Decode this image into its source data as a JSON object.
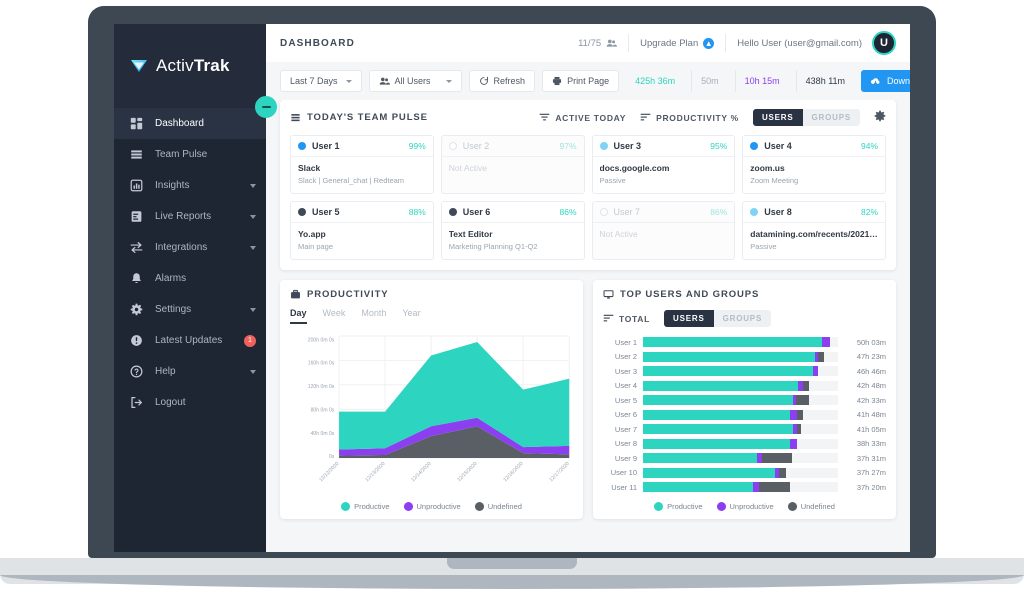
{
  "brand": {
    "name_light": "Activ",
    "name_bold": "Trak"
  },
  "sidebar": {
    "items": [
      {
        "label": "Dashboard",
        "icon": "grid-icon",
        "active": true,
        "chevron": false,
        "badge": null
      },
      {
        "label": "Team Pulse",
        "icon": "layers-icon",
        "active": false,
        "chevron": false,
        "badge": null
      },
      {
        "label": "Insights",
        "icon": "bar-chart-icon",
        "active": false,
        "chevron": true,
        "badge": null
      },
      {
        "label": "Live Reports",
        "icon": "report-icon",
        "active": false,
        "chevron": true,
        "badge": null
      },
      {
        "label": "Integrations",
        "icon": "arrows-icon",
        "active": false,
        "chevron": true,
        "badge": null
      },
      {
        "label": "Alarms",
        "icon": "bell-icon",
        "active": false,
        "chevron": false,
        "badge": null
      },
      {
        "label": "Settings",
        "icon": "gear-icon",
        "active": false,
        "chevron": true,
        "badge": null
      },
      {
        "label": "Latest Updates",
        "icon": "alert-icon",
        "active": false,
        "chevron": false,
        "badge": "1"
      },
      {
        "label": "Help",
        "icon": "question-icon",
        "active": false,
        "chevron": true,
        "badge": null
      },
      {
        "label": "Logout",
        "icon": "logout-icon",
        "active": false,
        "chevron": false,
        "badge": null
      }
    ],
    "collapse_icon": "minus-icon"
  },
  "header": {
    "title": "DASHBOARD",
    "seats": "11/75",
    "seats_icon": "users-icon",
    "upgrade_label": "Upgrade Plan",
    "upgrade_icon": "upgrade-icon",
    "greeting": "Hello User",
    "email": "(user@gmail.com)",
    "avatar_initial": "U"
  },
  "toolbar": {
    "date_range": "Last 7 Days",
    "user_filter": "All Users",
    "user_filter_icon": "people-icon",
    "refresh": "Refresh",
    "refresh_icon": "refresh-icon",
    "print": "Print Page",
    "print_icon": "printer-icon",
    "stat_productive": "425h 36m",
    "stat_unproductive": "50m",
    "stat_undefined": "10h 15m",
    "stat_total": "438h 11m",
    "download": "Download Agent",
    "download_icon": "cloud-download-icon",
    "colors": {
      "productive": "#2dd4bf",
      "unproductive": "#9b9ba4",
      "undefined": "#8b3ff0",
      "total": "#2f3945",
      "accent_blue": "#2196f3"
    }
  },
  "team_pulse": {
    "title": "TODAY'S TEAM PULSE",
    "title_icon": "pulse-icon",
    "sort_active": "ACTIVE TODAY",
    "sort_active_icon": "filter-icon",
    "sort_productivity": "PRODUCTIVITY %",
    "sort_productivity_icon": "sort-icon",
    "seg_users": "USERS",
    "seg_groups": "GROUPS",
    "settings_icon": "gear-icon",
    "cards": [
      {
        "name": "User 1",
        "pct": "99%",
        "app": "Slack",
        "sub": "Slack | General_chat | Redteam",
        "dot": "#2196f3",
        "active": true
      },
      {
        "name": "User 2",
        "pct": "97%",
        "app": "Not Active",
        "sub": "",
        "dot": "#ffffff",
        "active": false
      },
      {
        "name": "User 3",
        "pct": "95%",
        "app": "docs.google.com",
        "sub": "Passive",
        "dot": "#7fd4f5",
        "active": true
      },
      {
        "name": "User 4",
        "pct": "94%",
        "app": "zoom.us",
        "sub": "Zoom Meeting",
        "dot": "#2196f3",
        "active": true
      },
      {
        "name": "User 5",
        "pct": "88%",
        "app": "Yo.app",
        "sub": "Main page",
        "dot": "#3f4a58",
        "active": true
      },
      {
        "name": "User 6",
        "pct": "86%",
        "app": "Text Editor",
        "sub": "Marketing Planning Q1-Q2",
        "dot": "#3f4a58",
        "active": true
      },
      {
        "name": "User 7",
        "pct": "86%",
        "app": "Not Active",
        "sub": "",
        "dot": "#ffffff",
        "active": false
      },
      {
        "name": "User 8",
        "pct": "82%",
        "app": "datamining.com/recents/2021-r...",
        "sub": "Passive",
        "dot": "#7fd4f5",
        "active": true
      }
    ]
  },
  "productivity_panel": {
    "title": "PRODUCTIVITY",
    "title_icon": "briefcase-icon",
    "tabs": [
      {
        "label": "Day",
        "active": true
      },
      {
        "label": "Week",
        "active": false
      },
      {
        "label": "Month",
        "active": false
      },
      {
        "label": "Year",
        "active": false
      }
    ],
    "legend": [
      {
        "label": "Productive",
        "color": "#2dd4bf",
        "icon": "check-circle-icon"
      },
      {
        "label": "Unproductive",
        "color": "#8b3ff0",
        "icon": "minus-circle-icon"
      },
      {
        "label": "Undefined",
        "color": "#5a5f66",
        "icon": "question-circle-icon"
      }
    ]
  },
  "top_users_panel": {
    "title": "TOP USERS AND GROUPS",
    "title_icon": "monitor-icon",
    "total_label": "TOTAL",
    "total_icon": "sort-icon",
    "seg_users": "USERS",
    "seg_groups": "GROUPS",
    "legend": [
      {
        "label": "Productive",
        "color": "#2dd4bf",
        "icon": "check-circle-icon"
      },
      {
        "label": "Unproductive",
        "color": "#8b3ff0",
        "icon": "minus-circle-icon"
      },
      {
        "label": "Undefined",
        "color": "#5a5f66",
        "icon": "question-circle-icon"
      }
    ]
  },
  "chart_data": [
    {
      "type": "area",
      "stacked": true,
      "title": "PRODUCTIVITY",
      "xlabel": "",
      "ylabel": "",
      "grid": true,
      "legend_position": "bottom",
      "x": [
        "12/12/2020",
        "12/13/2020",
        "12/14/2020",
        "12/15/2020",
        "12/16/2020",
        "12/17/2020"
      ],
      "ytick_labels": [
        "200h 0m 0s",
        "160h 0m 0s",
        "120h 0m 0s",
        "80h 0m 0s",
        "40h 0m 0s",
        "0s"
      ],
      "ytick_values": [
        200,
        160,
        120,
        80,
        40,
        0
      ],
      "ylim": [
        0,
        200
      ],
      "series": [
        {
          "name": "Undefined",
          "color": "#5a5f66",
          "values": [
            4,
            5,
            36,
            52,
            8,
            6
          ]
        },
        {
          "name": "Unproductive",
          "color": "#8b3ff0",
          "values": [
            10,
            11,
            16,
            14,
            10,
            14
          ]
        },
        {
          "name": "Productive",
          "color": "#2dd4bf",
          "values": [
            62,
            60,
            116,
            124,
            94,
            110
          ]
        }
      ]
    },
    {
      "type": "bar",
      "orientation": "horizontal",
      "stacked": true,
      "title": "TOP USERS AND GROUPS",
      "grid": false,
      "legend_position": "bottom",
      "categories": [
        "User 1",
        "User 2",
        "User 3",
        "User 4",
        "User 5",
        "User 6",
        "User 7",
        "User 8",
        "User 9",
        "User 10",
        "User 11"
      ],
      "totals": [
        "50h 03m",
        "47h 23m",
        "46h 46m",
        "42h 48m",
        "42h 33m",
        "41h 48m",
        "41h 05m",
        "38h 33m",
        "37h 31m",
        "37h 27m",
        "37h 20m"
      ],
      "series": [
        {
          "name": "Productive",
          "color": "#2dd4bf",
          "values": [
            92.0,
            88.0,
            87.0,
            79.5,
            77.0,
            75.5,
            77.0,
            75.5,
            58.5,
            67.5,
            56.5
          ]
        },
        {
          "name": "Unproductive",
          "color": "#8b3ff0",
          "values": [
            4.0,
            2.0,
            3.0,
            2.5,
            1.5,
            3.5,
            2.0,
            3.5,
            2.5,
            2.0,
            3.0
          ]
        },
        {
          "name": "Undefined",
          "color": "#5a5f66",
          "values": [
            0.0,
            3.0,
            0.0,
            3.0,
            6.5,
            3.0,
            2.0,
            0.0,
            15.5,
            4.0,
            16.0
          ]
        }
      ],
      "xlim": [
        0,
        100
      ]
    }
  ]
}
